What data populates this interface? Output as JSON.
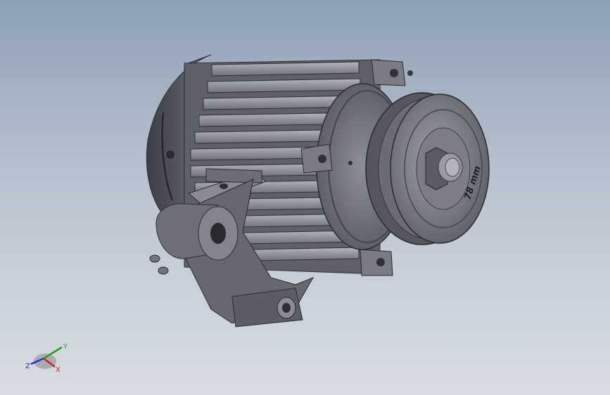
{
  "viewport": {
    "background_top": "#8fa0b6",
    "background_bottom": "#d9dde3"
  },
  "model": {
    "pulley_engraving": "78 mm",
    "body_color": "#6e6f78",
    "fin_color": "#9a9ba4",
    "pulley_color": "#8c8d94"
  },
  "triad": {
    "x_label": "X",
    "y_label": "Y",
    "z_label": "Z",
    "x_color": "#d02020",
    "y_color": "#20a020",
    "z_color": "#2030d0"
  }
}
